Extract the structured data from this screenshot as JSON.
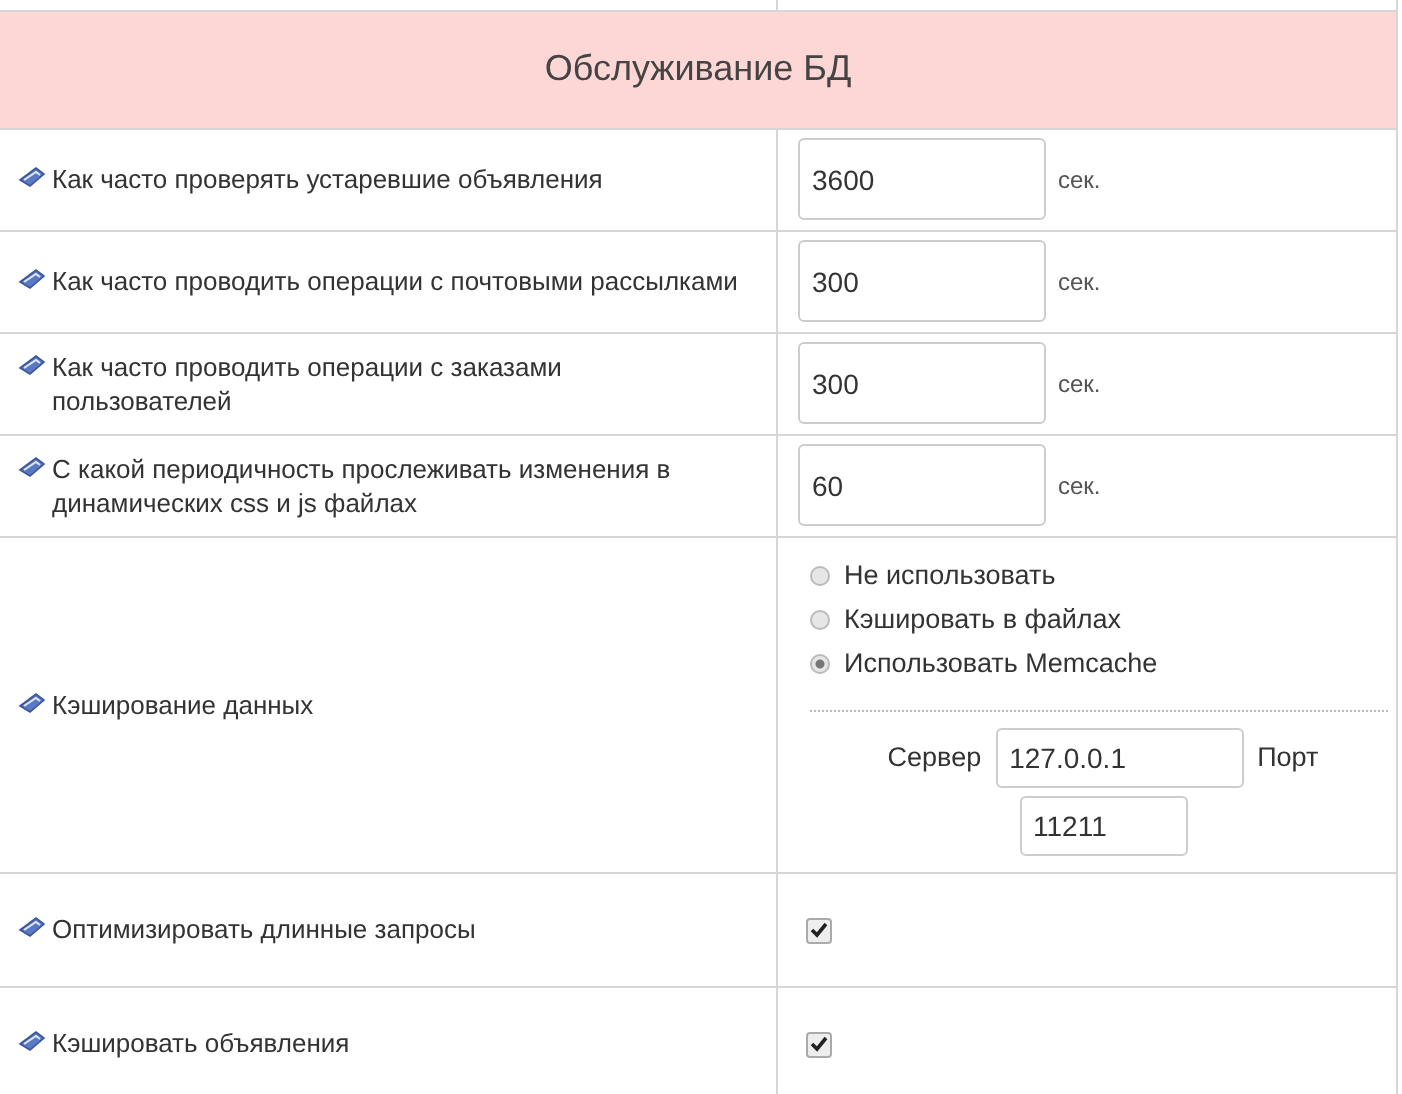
{
  "section_title": "Обслуживание БД",
  "rows": [
    {
      "kind": "number",
      "label": "Как часто проверять устаревшие объявления",
      "value": "3600",
      "unit": "сек."
    },
    {
      "kind": "number",
      "label": "Как часто проводить операции с почтовыми рассылками",
      "value": "300",
      "unit": "сек."
    },
    {
      "kind": "number",
      "label": "Как часто проводить операции с заказами пользователей",
      "value": "300",
      "unit": "сек."
    },
    {
      "kind": "number",
      "label": "С какой периодичность прослеживать изменения в динамических css и js файлах",
      "value": "60",
      "unit": "сек."
    },
    {
      "kind": "cache",
      "label": "Кэширование данных",
      "options": [
        {
          "label": "Не использовать",
          "selected": false
        },
        {
          "label": "Кэшировать в файлах",
          "selected": false
        },
        {
          "label": "Использовать Memcache",
          "selected": true
        }
      ],
      "server_label": "Сервер",
      "server": "127.0.0.1",
      "port_label": "Порт",
      "port": "11211"
    },
    {
      "kind": "checkbox",
      "label": "Оптимизировать длинные запросы",
      "checked": true
    },
    {
      "kind": "checkbox",
      "label": "Кэшировать объявления",
      "checked": true
    }
  ]
}
